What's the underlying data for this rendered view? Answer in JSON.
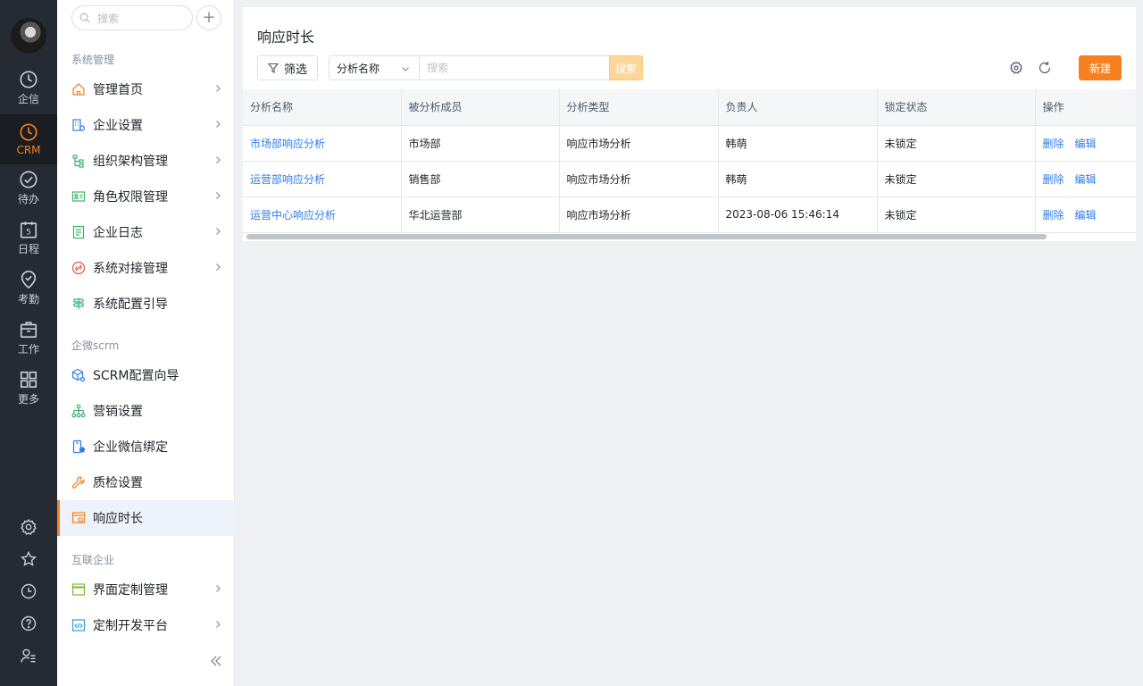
{
  "rail": {
    "items": [
      {
        "label": "企信",
        "icon": "clock-icon"
      },
      {
        "label": "CRM",
        "icon": "crm-icon"
      },
      {
        "label": "待办",
        "icon": "check-circle-icon"
      },
      {
        "label": "日程",
        "icon": "calendar-icon",
        "badge": "5"
      },
      {
        "label": "考勤",
        "icon": "location-check-icon"
      },
      {
        "label": "工作",
        "icon": "briefcase-icon"
      },
      {
        "label": "更多",
        "icon": "grid-icon"
      }
    ],
    "active_color": "#f7811f"
  },
  "sidebar": {
    "search_placeholder": "搜索",
    "group_system": "系统管理",
    "group_scrm": "企微scrm",
    "group_interconnect": "互联企业",
    "items": [
      {
        "label": "管理首页"
      },
      {
        "label": "企业设置"
      },
      {
        "label": "组织架构管理"
      },
      {
        "label": "角色权限管理"
      },
      {
        "label": "企业日志"
      },
      {
        "label": "系统对接管理"
      },
      {
        "label": "系统配置引导"
      },
      {
        "label": "SCRM配置向导"
      },
      {
        "label": "营销设置"
      },
      {
        "label": "企业微信绑定"
      },
      {
        "label": "质检设置"
      },
      {
        "label": "响应时长"
      },
      {
        "label": "界面定制管理"
      },
      {
        "label": "定制开发平台"
      }
    ]
  },
  "main": {
    "title": "响应时长",
    "filter_label": "筛选",
    "field_select": "分析名称",
    "search_placeholder": "搜索",
    "search_button": "搜索",
    "new_button": "新建",
    "columns": [
      "分析名称",
      "被分析成员",
      "分析类型",
      "负责人",
      "锁定状态",
      "操作"
    ],
    "rows": [
      {
        "name": "市场部响应分析",
        "member": "市场部",
        "type": "响应市场分析",
        "owner": "韩萌",
        "lock": "未锁定"
      },
      {
        "name": "运营部响应分析",
        "member": "销售部",
        "type": "响应市场分析",
        "owner": "韩萌",
        "lock": "未锁定"
      },
      {
        "name": "运营中心响应分析",
        "member": "华北运营部",
        "type": "响应市场分析",
        "owner": "2023-08-06 15:46:14",
        "lock": "未锁定"
      }
    ],
    "op_delete": "删除",
    "op_edit": "编辑"
  }
}
